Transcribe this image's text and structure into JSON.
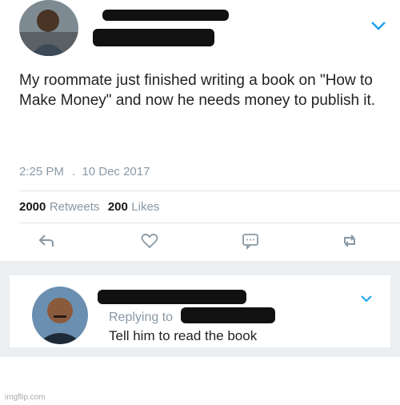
{
  "tweet": {
    "text": "My roommate just finished writing a book on \"How to Make Money\" and now he needs money to publish it.",
    "time": "2:25 PM",
    "separator": ".",
    "date": "10 Dec 2017",
    "retweets_count": "2000",
    "retweets_label": "Retweets",
    "likes_count": "200",
    "likes_label": "Likes"
  },
  "reply": {
    "replying_to_label": "Replying to",
    "text": "Tell him to read the book"
  },
  "watermark": "imgflip.com",
  "colors": {
    "accent": "#1da1f2",
    "muted": "#8899a6"
  }
}
